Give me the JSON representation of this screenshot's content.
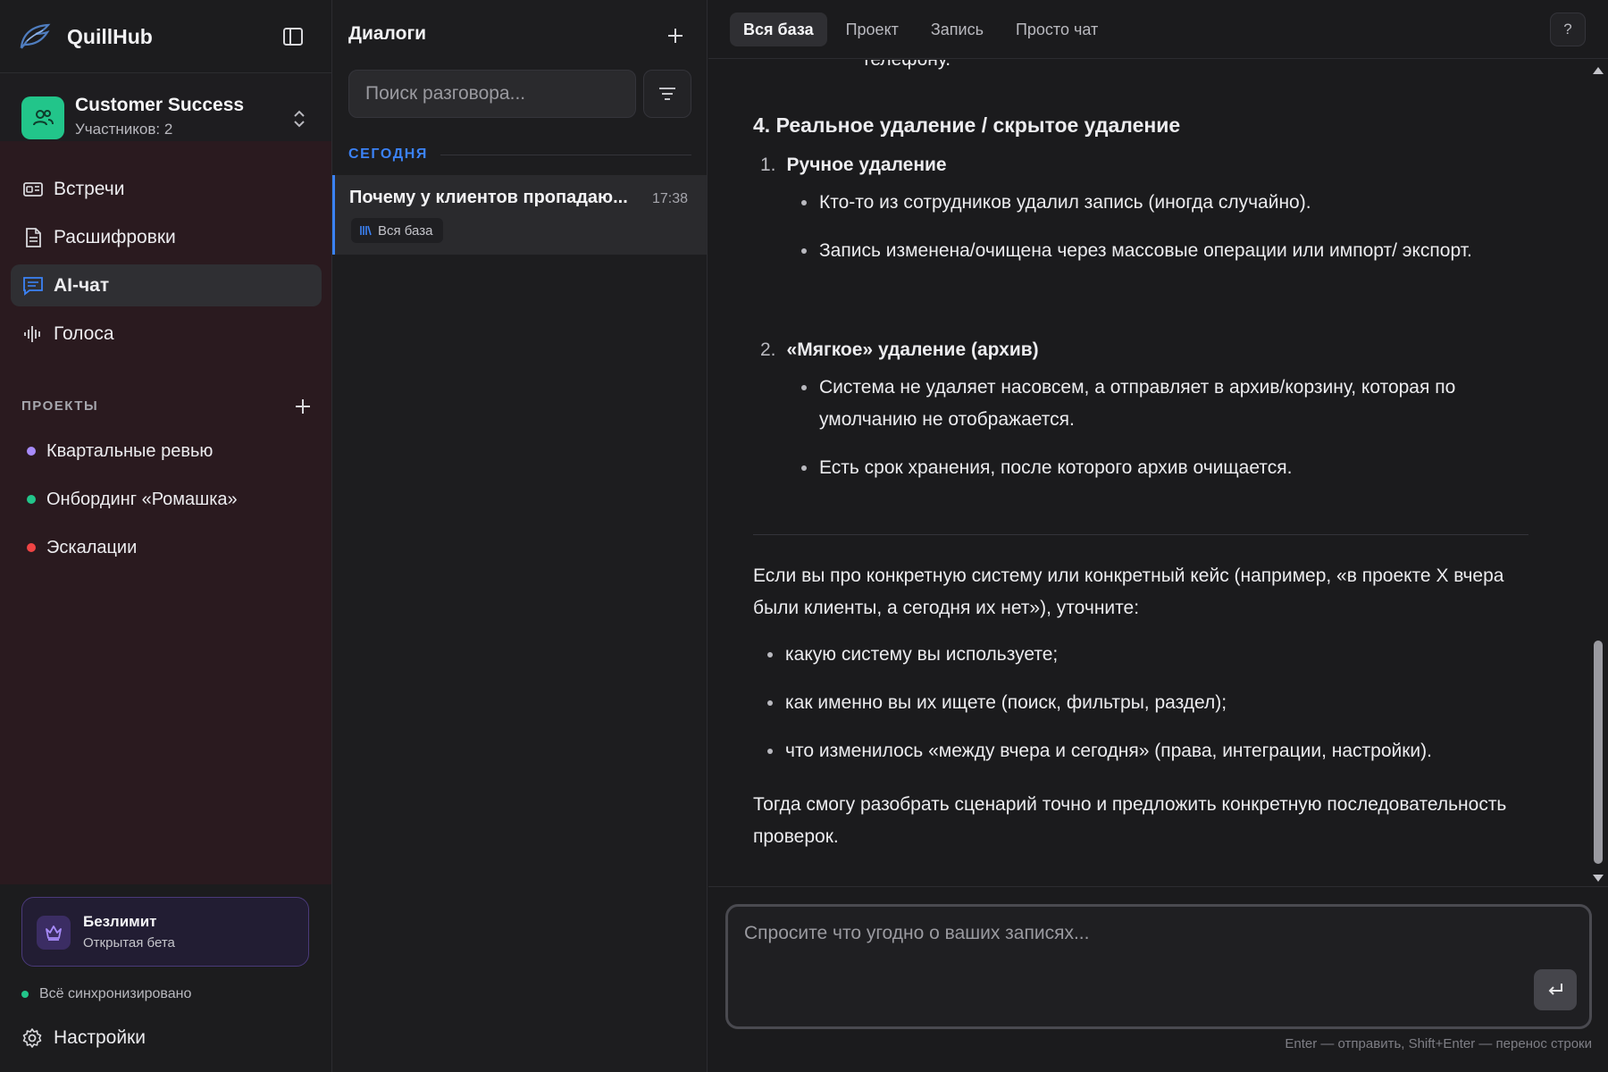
{
  "app": {
    "title": "QuillHub"
  },
  "workspace": {
    "name": "Customer Success",
    "members": "Участников: 2"
  },
  "nav": [
    {
      "label": "Встречи",
      "icon": "meetings-icon"
    },
    {
      "label": "Расшифровки",
      "icon": "transcripts-icon"
    },
    {
      "label": "AI-чат",
      "icon": "chat-icon",
      "active": true
    },
    {
      "label": "Голоса",
      "icon": "voices-icon"
    }
  ],
  "projects": {
    "title": "ПРОЕКТЫ",
    "items": [
      {
        "label": "Квартальные ревью",
        "color": "#a78bfa"
      },
      {
        "label": "Онбординг «Ромашка»",
        "color": "#22c58a"
      },
      {
        "label": "Эскалации",
        "color": "#ef4444"
      }
    ]
  },
  "plan": {
    "title": "Безлимит",
    "subtitle": "Открытая бета"
  },
  "sync": {
    "label": "Всё синхронизировано"
  },
  "settings": {
    "label": "Настройки"
  },
  "dialogs": {
    "title": "Диалоги",
    "search_placeholder": "Поиск разговора...",
    "section": "СЕГОДНЯ",
    "items": [
      {
        "title": "Почему у клиентов пропадаю...",
        "time": "17:38",
        "tag": "Вся база"
      }
    ]
  },
  "tabs": [
    {
      "label": "Вся база",
      "active": true
    },
    {
      "label": "Проект"
    },
    {
      "label": "Запись"
    },
    {
      "label": "Просто чат"
    }
  ],
  "help": "?",
  "message": {
    "cut_line": "телефону.",
    "heading": "4. Реальное удаление / скрытое удаление",
    "sections": [
      {
        "num": "1.",
        "title": "Ручное удаление",
        "bullets": [
          "Кто-то из сотрудников удалил запись (иногда случайно).",
          "Запись изменена/очищена через массовые операции или импорт/ экспорт."
        ]
      },
      {
        "num": "2.",
        "title": "«Мягкое» удаление (архив)",
        "bullets": [
          "Система не удаляет насовсем, а отправляет в архив/корзину, которая по умолчанию не отображается.",
          "Есть срок хранения, после которого архив очищается."
        ]
      }
    ],
    "intro": "Если вы про конкретную систему или конкретный кейс (например, «в проекте X вчера были клиенты, а сегодня их нет»), уточните:",
    "questions": [
      "какую систему вы используете;",
      "как именно вы их ищете (поиск, фильтры, раздел);",
      "что изменилось «между вчера и сегодня» (права, интеграции, настройки)."
    ],
    "closing": "Тогда смогу разобрать сценарий точно и предложить конкретную последовательность проверок."
  },
  "composer": {
    "placeholder": "Спросите что угодно о ваших записях...",
    "hint": "Enter — отправить, Shift+Enter — перенос строки"
  },
  "colors": {
    "accent": "#3b82f6",
    "brand_green": "#22c58a",
    "plan_purple": "#a78bfa"
  }
}
